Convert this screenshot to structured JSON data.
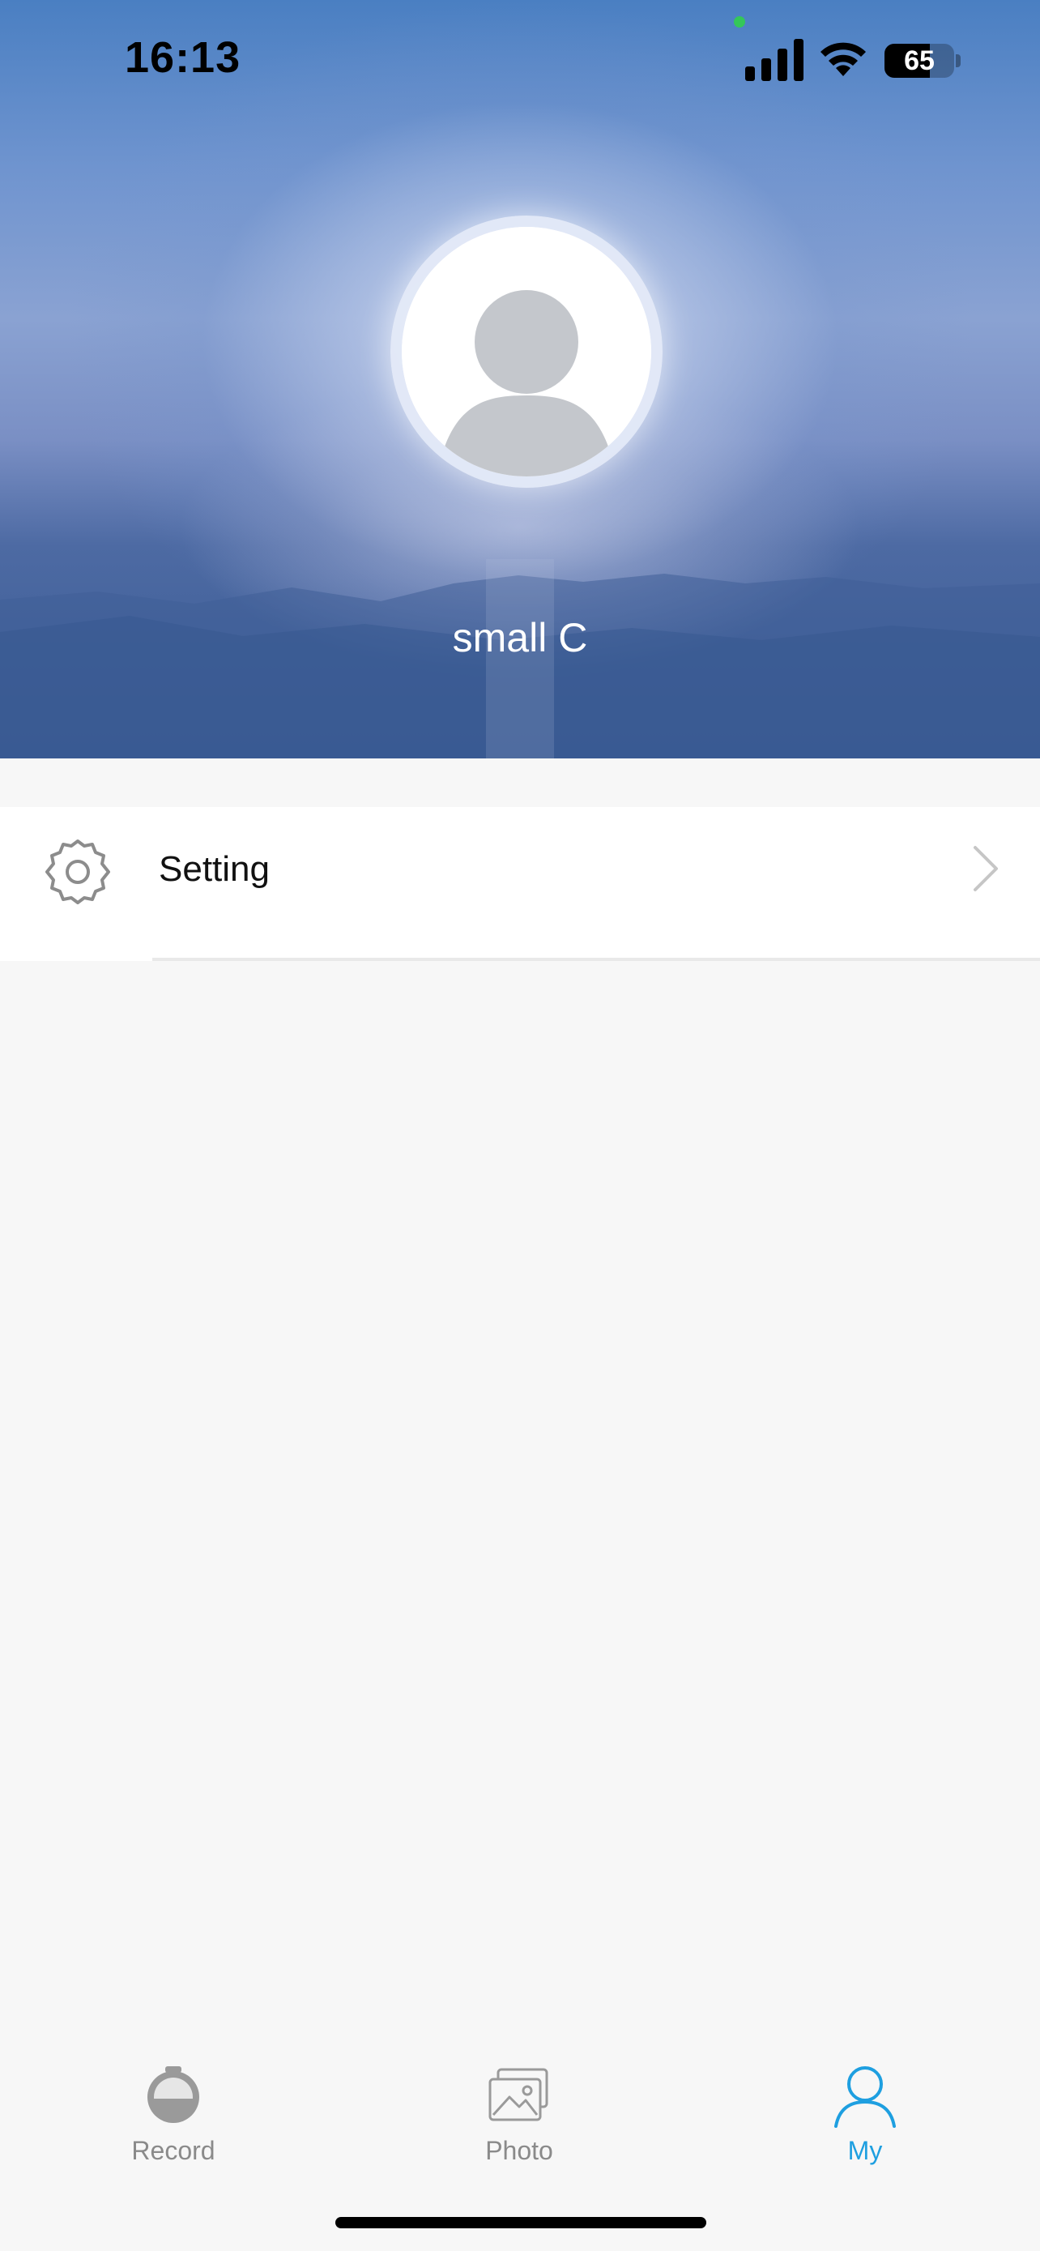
{
  "status_bar": {
    "time": "16:13",
    "battery_level": "65",
    "battery_fraction": 0.65
  },
  "profile": {
    "username": "small C"
  },
  "menu": {
    "items": [
      {
        "label": "Setting",
        "icon": "gear-icon"
      }
    ]
  },
  "tab_bar": {
    "items": [
      {
        "label": "Record",
        "icon": "record-icon",
        "active": false
      },
      {
        "label": "Photo",
        "icon": "photo-icon",
        "active": false
      },
      {
        "label": "My",
        "icon": "person-icon",
        "active": true
      }
    ],
    "active_color": "#1e9fe0",
    "inactive_color": "#8a8a8a"
  }
}
